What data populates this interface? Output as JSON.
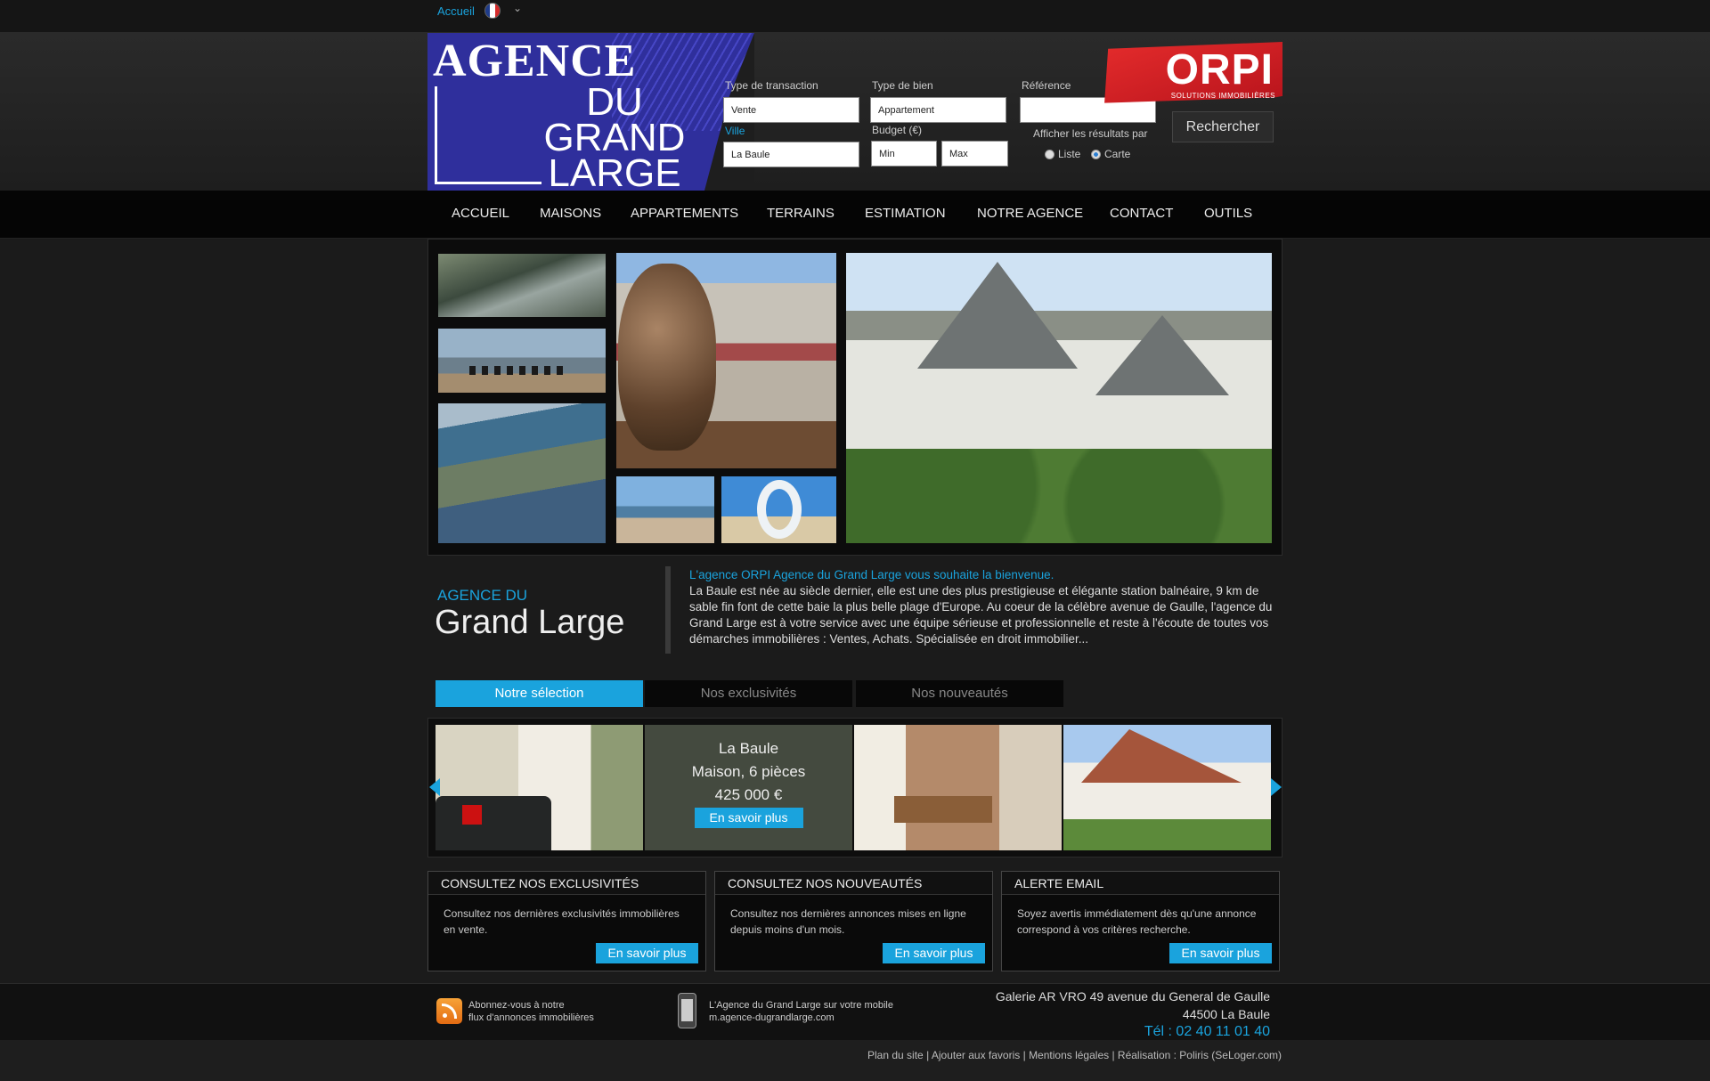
{
  "topbar": {
    "home_link": "Accueil",
    "flag_colors": [
      "#1f3c8a",
      "#ffffff",
      "#d52b2b"
    ]
  },
  "logo": {
    "line1": "AGENCE",
    "line2": "DU",
    "line3": "GRAND",
    "line4": "LARGE"
  },
  "orpi": {
    "name": "ORPI",
    "tagline": "SOLUTIONS IMMOBILIÈRES",
    "color": "#d71f26"
  },
  "search": {
    "transaction_label": "Type de transaction",
    "transaction_value": "Vente",
    "property_label": "Type de bien",
    "property_value": "Appartement",
    "reference_label": "Référence",
    "reference_value": "",
    "city_label": "Ville",
    "city_value": "La Baule",
    "budget_label": "Budget (€)",
    "budget_min": "Min",
    "budget_max": "Max",
    "display_label": "Afficher les résultats par",
    "option_list": "Liste",
    "option_map": "Carte",
    "selected": "Carte",
    "submit": "Rechercher"
  },
  "nav": {
    "items": [
      "ACCUEIL",
      "MAISONS",
      "APPARTEMENTS",
      "TERRAINS",
      "ESTIMATION",
      "NOTRE AGENCE",
      "CONTACT",
      "OUTILS"
    ]
  },
  "intro": {
    "title_small": "AGENCE DU",
    "title_large": "Grand Large",
    "welcome": "L'agence ORPI Agence du Grand Large vous souhaite la bienvenue.",
    "body": "La Baule est née au siècle dernier, elle est une des plus prestigieuse et élégante station balnéaire, 9 km de sable fin font de cette baie la plus belle plage d'Europe. Au coeur de la célèbre avenue de Gaulle, l'agence du Grand Large est à votre service avec une équipe sérieuse et professionnelle et reste à l'écoute de toutes vos démarches immobilières : Ventes, Achats. Spécialisée en droit immobilier..."
  },
  "tabs": [
    "Notre sélection",
    "Nos exclusivités",
    "Nos nouveautés"
  ],
  "featured": {
    "city": "La Baule",
    "type": "Maison, 6 pièces",
    "price": "425 000 €",
    "more": "En savoir plus"
  },
  "boxes": [
    {
      "title": "CONSULTEZ NOS EXCLUSIVITÉS",
      "text": "Consultez nos dernières exclusivités immobilières en vente.",
      "button": "En savoir plus"
    },
    {
      "title": "CONSULTEZ NOS NOUVEAUTÉS",
      "text": "Consultez nos dernières annonces mises en ligne depuis moins d'un mois.",
      "button": "En savoir plus"
    },
    {
      "title": "ALERTE EMAIL",
      "text": "Soyez avertis immédiatement dès qu'une annonce correspond à vos critères recherche.",
      "button": "En savoir plus"
    }
  ],
  "footer": {
    "rss_line1": "Abonnez-vous à notre",
    "rss_line2": "flux d'annonces immobilières",
    "mobile_line1": "L'Agence du Grand Large sur votre mobile",
    "mobile_line2": "m.agence-dugrandlarge.com",
    "address_line1": "Galerie AR VRO  49 avenue du General de Gaulle",
    "address_line2": "44500 La Baule",
    "phone": "Tél : 02 40 11 01 40"
  },
  "bottom_links": [
    "Plan du site",
    "Ajouter aux favoris",
    "Mentions légales",
    "Réalisation : Poliris (SeLoger.com)"
  ],
  "colors": {
    "accent": "#1aa3dd",
    "background": "#1b1b1b",
    "nav": "#050505"
  }
}
